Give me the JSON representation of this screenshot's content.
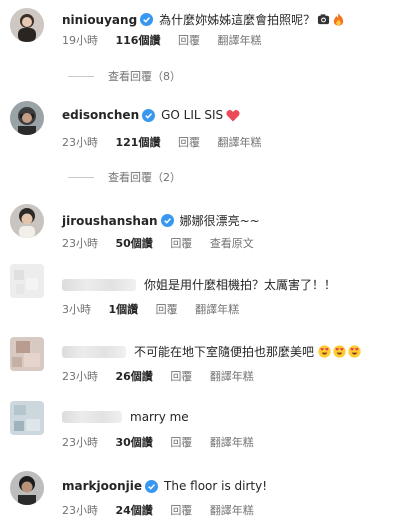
{
  "comments": [
    {
      "username": "niniouyang",
      "text": "為什麼妳姊姊這麼會拍照呢？",
      "time": "19小時",
      "likes": "116個讚",
      "reply": "回覆",
      "translate": "翻譯年糕",
      "view_replies": "查看回覆（8）",
      "emoji": [
        "camera-emoji",
        "fire-emoji"
      ]
    },
    {
      "username": "edisonchen",
      "text": "GO LIL SIS",
      "time": "23小時",
      "likes": "121個讚",
      "reply": "回覆",
      "translate": "翻譯年糕",
      "view_replies": "查看回覆（2）",
      "emoji": [
        "red-heart-emoji"
      ]
    },
    {
      "username": "jiroushanshan",
      "text": "娜娜很漂亮~~",
      "time": "23小時",
      "likes": "50個讚",
      "reply": "回覆",
      "translate": "查看原文"
    },
    {
      "username": "",
      "text": "你姐是用什麼相機拍？太厲害了！！",
      "time": "3小時",
      "likes": "1個讚",
      "reply": "回覆",
      "translate": "翻譯年糕"
    },
    {
      "username": "",
      "text": "不可能在地下室隨便拍也那麼美吧",
      "time": "23小時",
      "likes": "26個讚",
      "reply": "回覆",
      "translate": "翻譯年糕",
      "emoji": [
        "heart-eyes-emoji",
        "heart-eyes-emoji",
        "heart-eyes-emoji"
      ]
    },
    {
      "username": "",
      "text": "marry me",
      "time": "23小時",
      "likes": "30個讚",
      "reply": "回覆",
      "translate": "翻譯年糕"
    },
    {
      "username": "markjoonjie",
      "text": "The floor is dirty!",
      "time": "23小時",
      "likes": "24個讚",
      "reply": "回覆",
      "translate": "翻譯年糕"
    }
  ],
  "colors": {
    "verified": "#3897f0",
    "muted": "#737373",
    "text": "#262626",
    "heart": "#ed4956"
  }
}
